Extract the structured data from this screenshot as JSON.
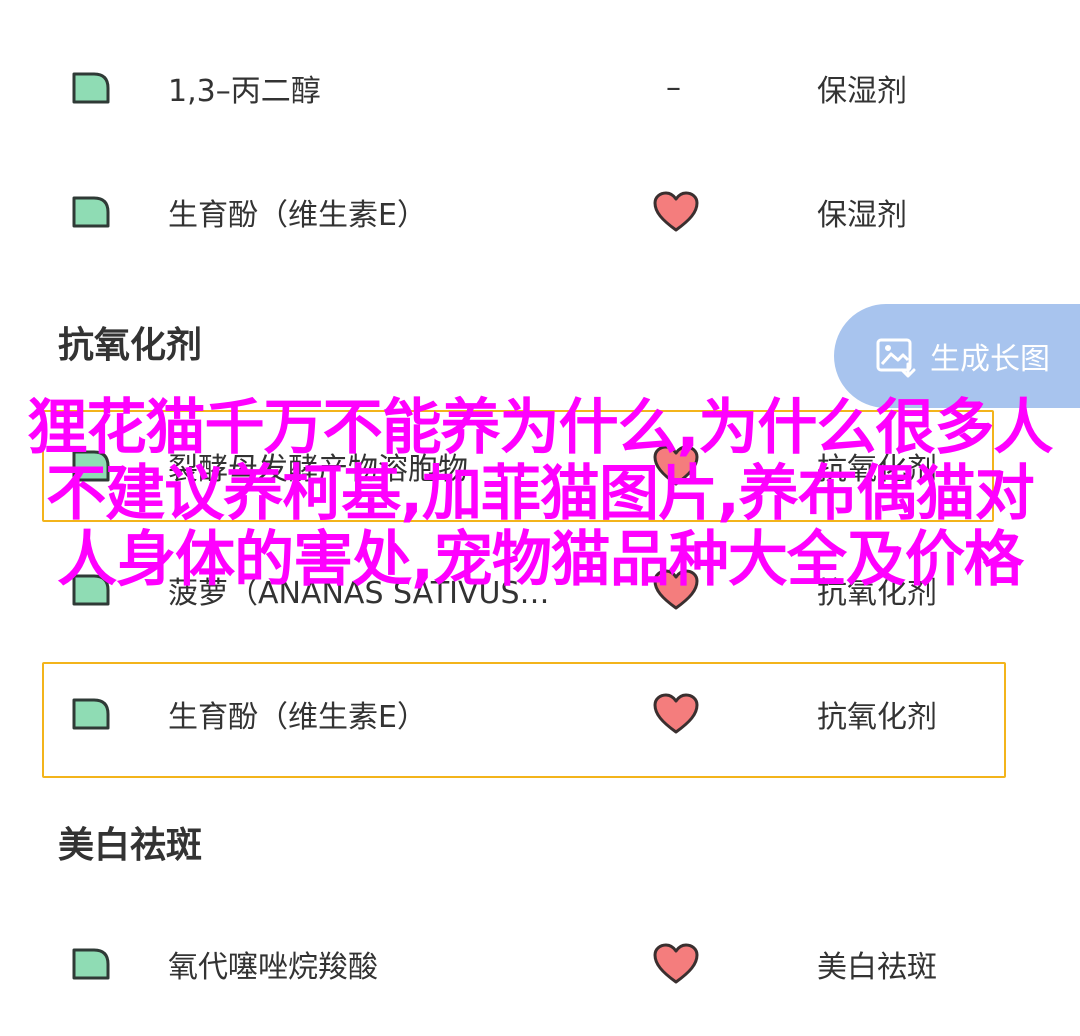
{
  "rows": [
    {
      "ingredient": "1,3–丙二醇",
      "mark": "–",
      "function": "保湿剂"
    },
    {
      "ingredient": "生育酚（维生素E）",
      "mark": "heart",
      "function": "保湿剂"
    },
    {
      "ingredient": "裂酵母发酵产物溶胞物",
      "mark": "heart",
      "function": "抗氧化剂"
    },
    {
      "ingredient": "菠萝（ANANAS SATIVUS…",
      "mark": "heart",
      "function": "抗氧化剂"
    },
    {
      "ingredient": "生育酚（维生素E）",
      "mark": "heart",
      "function": "抗氧化剂"
    },
    {
      "ingredient": "氧代噻唑烷羧酸",
      "mark": "heart",
      "function": "美白祛斑"
    }
  ],
  "sections": {
    "antioxidant": "抗氧化剂",
    "whitening": "美白祛斑"
  },
  "fab": {
    "label": "生成长图",
    "icon": "image-icon",
    "color": "#a8c4ee"
  },
  "overlay": {
    "text": "狸花猫千万不能养为什么,为什么很多人不建议养柯基,加菲猫图片,养布偶猫对人身体的害处,宠物猫品种大全及价格",
    "color": "#ff00ff"
  },
  "icons": {
    "leaf": "leaf-icon",
    "heart": "heart-icon"
  },
  "colors": {
    "leaf_fill": "#8fdcb4",
    "leaf_stroke": "#2f3a36",
    "heart_fill": "#f47d7d",
    "highlight_border": "#f3b41b"
  }
}
